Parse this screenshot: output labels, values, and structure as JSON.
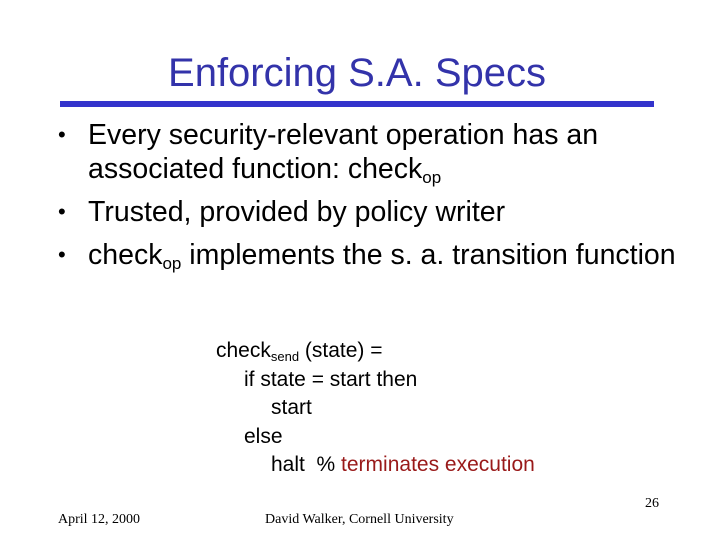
{
  "slide": {
    "title": "Enforcing S.A. Specs",
    "accent_color": "#3333aa",
    "bullets": [
      {
        "text_before": "Every security-relevant operation has an associated function: check",
        "sub": "op",
        "text_after": ""
      },
      {
        "text_before": "Trusted, provided by policy writer",
        "sub": "",
        "text_after": ""
      },
      {
        "text_before": "check",
        "sub": "op",
        "text_after": " implements the s. a. transition function"
      }
    ],
    "code": {
      "line1_a": "check",
      "line1_sub": "send",
      "line1_b": " (state) =",
      "line2": "if state = start then",
      "line3": "start",
      "line4": "else",
      "line5_a": "halt  % ",
      "line5_comment": "terminates execution",
      "comment_color": "#991919"
    },
    "footer": {
      "date": "April 12, 2000",
      "author": "David Walker, Cornell University",
      "page_number": "26"
    },
    "bullet_glyph": "•"
  }
}
